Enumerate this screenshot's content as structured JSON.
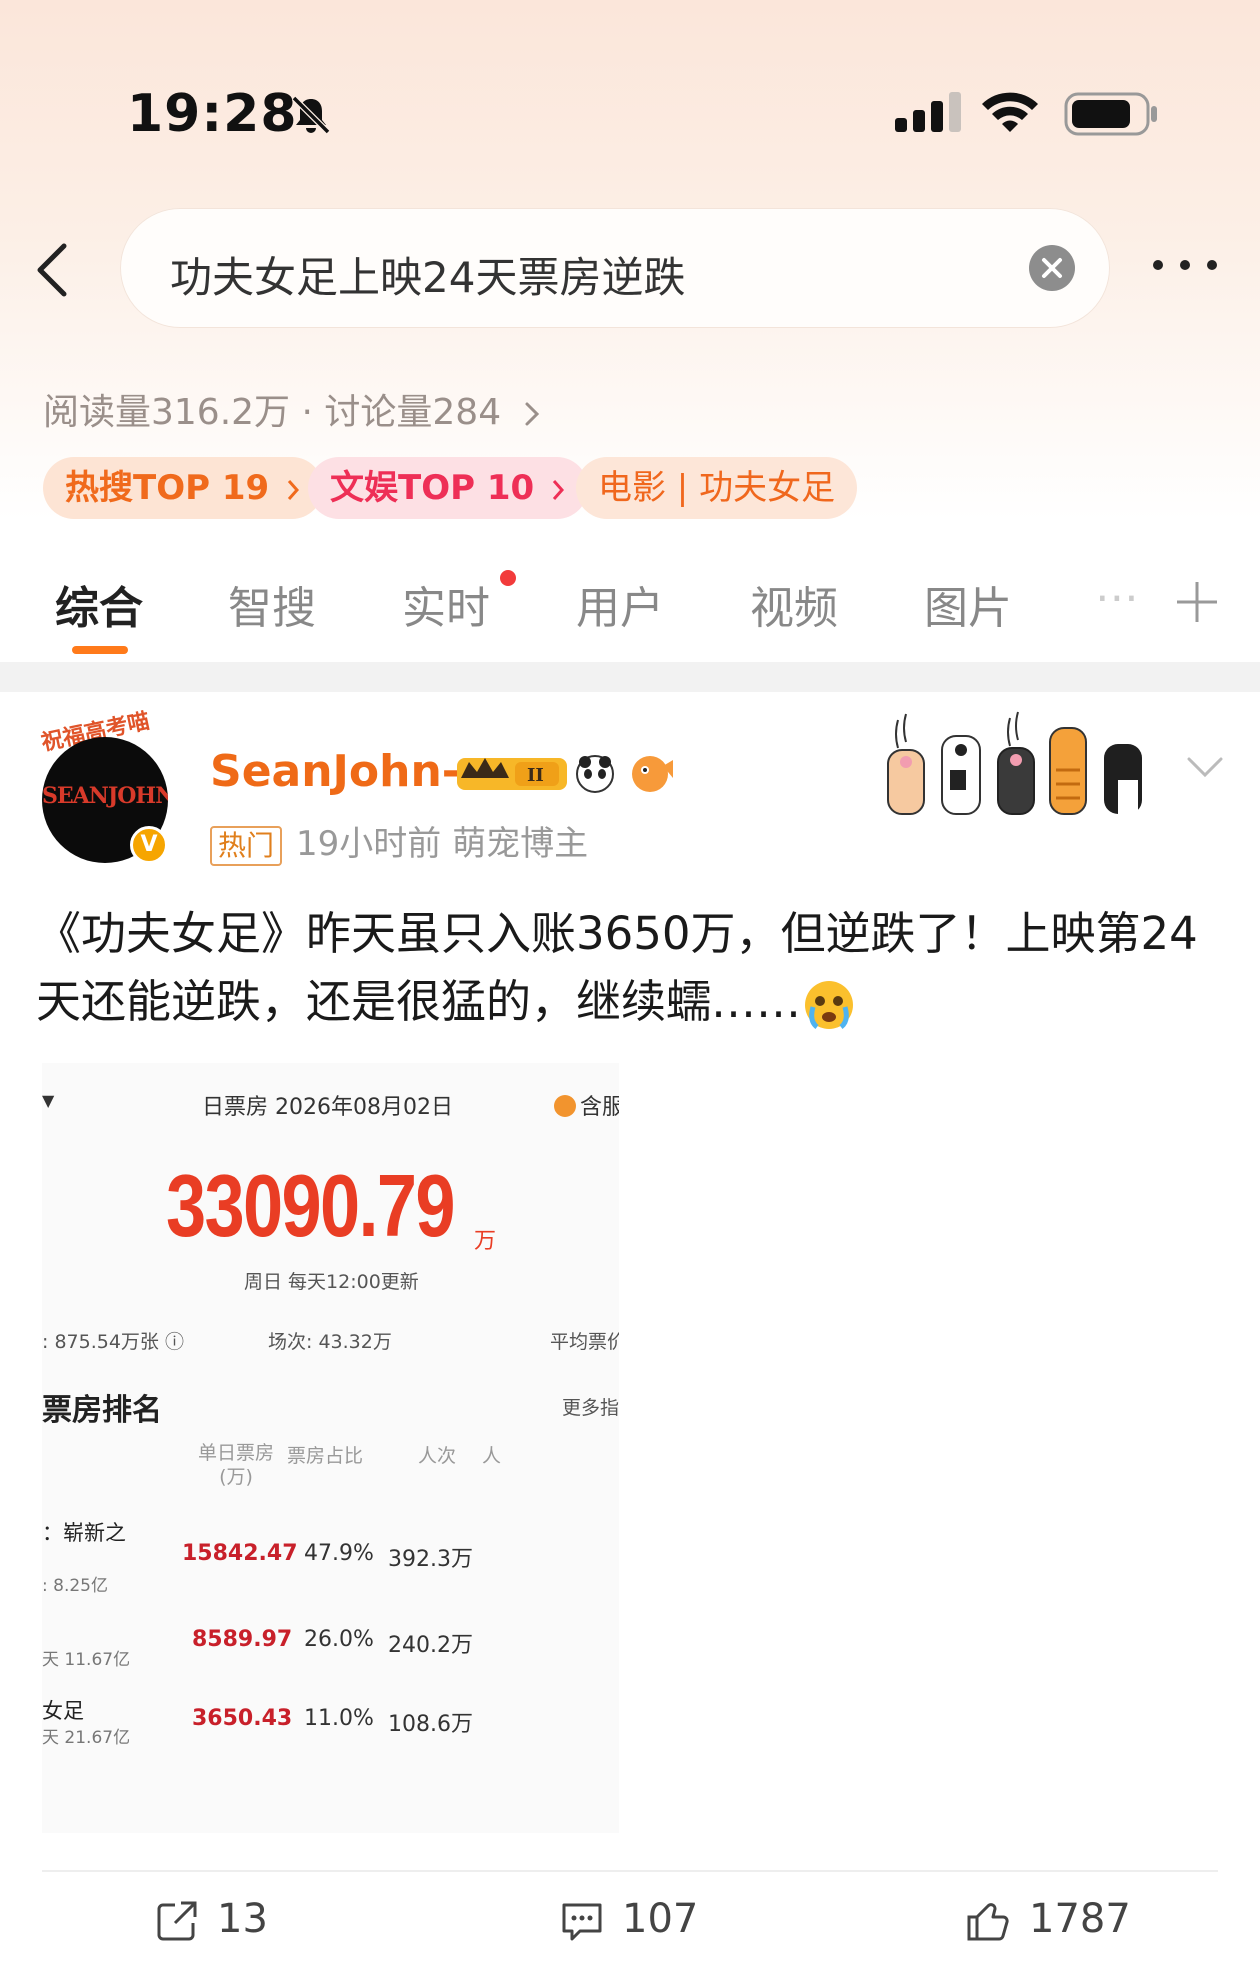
{
  "status_bar": {
    "time": "19:28"
  },
  "search": {
    "query": "功夫女足上映24天票房逆跌"
  },
  "stats": {
    "text": "阅读量316.2万 · 讨论量284"
  },
  "tags": [
    {
      "label": "热搜TOP 19"
    },
    {
      "label": "文娱TOP 10"
    },
    {
      "label": "电影 | 功夫女足"
    }
  ],
  "tabs": [
    {
      "label": "综合"
    },
    {
      "label": "智搜"
    },
    {
      "label": "实时"
    },
    {
      "label": "用户"
    },
    {
      "label": "视频"
    },
    {
      "label": "图片"
    }
  ],
  "post": {
    "avatar_banner": "祝福高考喵",
    "avatar_text": "SEANJOHN",
    "username": "SeanJohn-",
    "hot_label": "热门",
    "meta": "19小时前  萌宠博主",
    "text": "《功夫女足》昨天虽只入账3650万，但逆跌了！上映第24天还能逆跌，还是很猛的，继续蠕……",
    "image": {
      "date": "日票房 2026年08月02日",
      "tax": "含服",
      "total": "33090.79",
      "unit": "万",
      "sub": "周日  每天12:00更新",
      "m1": ": 875.54万张 ⓘ",
      "m2": "场次: 43.32万",
      "m3": "平均票价",
      "rank_title": "票房排名",
      "more": "更多指",
      "headers": [
        "单日票房\n(万)",
        "票房占比",
        "人次",
        "人"
      ],
      "rows": [
        {
          "name": "：崭新之",
          "sub": ": 8.25亿",
          "box": "15842.47",
          "share": "47.9%",
          "people": "392.3万"
        },
        {
          "name": "",
          "sub": "天 11.67亿",
          "box": "8589.97",
          "share": "26.0%",
          "people": "240.2万"
        },
        {
          "name": "女足",
          "sub": "天 21.67亿",
          "box": "3650.43",
          "share": "11.0%",
          "people": "108.6万"
        }
      ]
    },
    "actions": {
      "shares": "13",
      "comments": "107",
      "likes": "1787"
    }
  },
  "colors": {
    "accent": "#ff7a1a",
    "username": "#ef6a17",
    "hot_red": "#ee2f56",
    "box_office_red": "#e93d24"
  }
}
